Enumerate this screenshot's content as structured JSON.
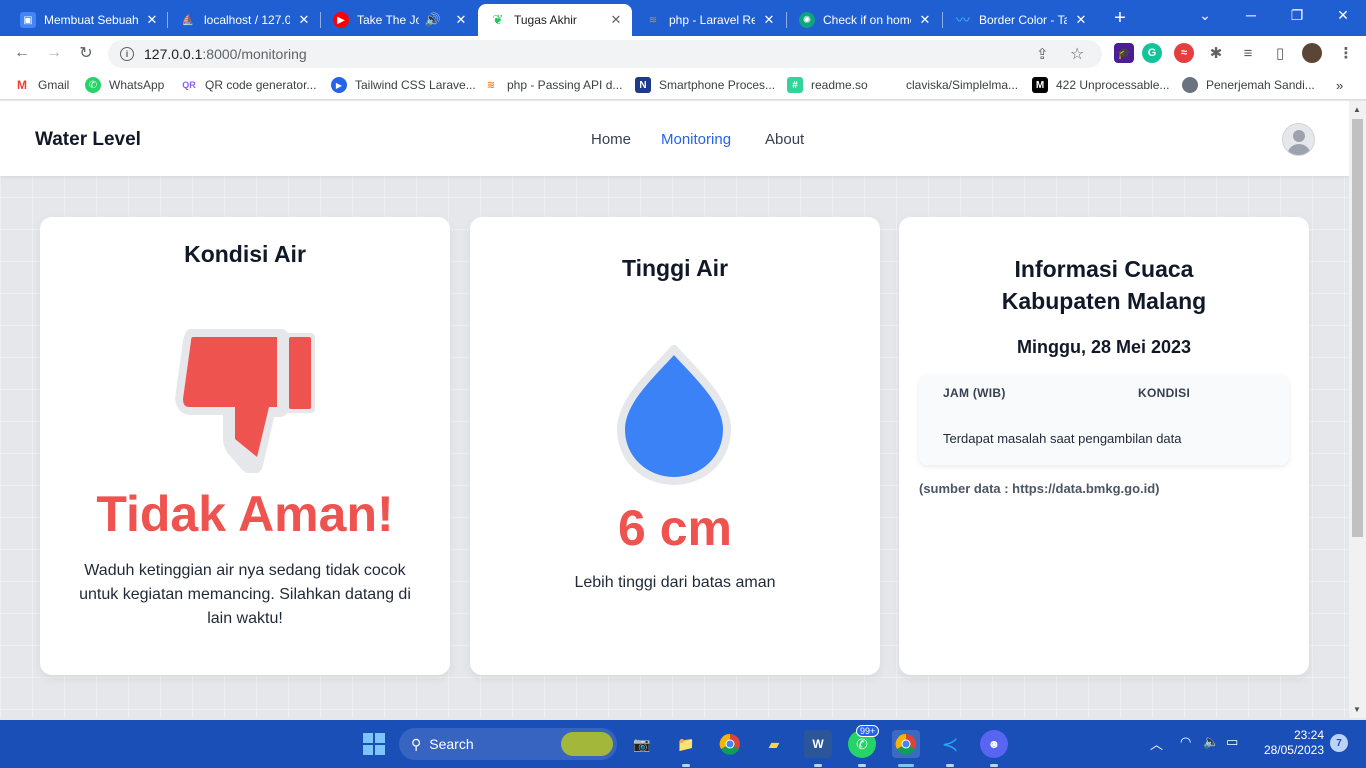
{
  "browser": {
    "tabs": [
      {
        "title": "Membuat Sebuah",
        "favicon": "profile-icon",
        "color": "#4285f4"
      },
      {
        "title": "localhost / 127.0.",
        "favicon": "phpmyadmin-icon",
        "color": "#f28c28"
      },
      {
        "title": "Take The Jour",
        "favicon": "youtube-music-icon",
        "color": "#ff0000"
      },
      {
        "title": "Tugas Akhir",
        "favicon": "leaf-icon",
        "color": "#22c55e"
      },
      {
        "title": "php - Laravel Re",
        "favicon": "stackoverflow-icon",
        "color": "#f48024"
      },
      {
        "title": "Check if on home",
        "favicon": "chatgpt-icon",
        "color": "#10a37f"
      },
      {
        "title": "Border Color - Ta",
        "favicon": "tailwind-icon",
        "color": "#38bdf8"
      }
    ],
    "url_host": "127.0.0.1",
    "url_path": ":8000/monitoring",
    "bookmarks": [
      {
        "label": "Gmail",
        "icon": "gmail-icon",
        "color": "#ea4335",
        "glyph": "M"
      },
      {
        "label": "WhatsApp",
        "icon": "whatsapp-icon",
        "color": "#25d366",
        "glyph": "W"
      },
      {
        "label": "QR code generator...",
        "icon": "qr-icon",
        "color": "#8b5cf6",
        "glyph": "QR"
      },
      {
        "label": "Tailwind CSS Larave...",
        "icon": "play-icon",
        "color": "#2563eb",
        "glyph": "▶"
      },
      {
        "label": "php - Passing API d...",
        "icon": "stackoverflow-icon",
        "color": "#f48024",
        "glyph": "S"
      },
      {
        "label": "Smartphone Proces...",
        "icon": "notion-icon",
        "color": "#1e3a8a",
        "glyph": "N"
      },
      {
        "label": "readme.so",
        "icon": "hash-icon",
        "color": "#34d399",
        "glyph": "#"
      },
      {
        "label": "claviska/Simplelma...",
        "icon": "blank-icon",
        "color": "#ffffff",
        "glyph": ""
      },
      {
        "label": "422 Unprocessable...",
        "icon": "medium-icon",
        "color": "#000000",
        "glyph": "M"
      },
      {
        "label": "Penerjemah Sandi...",
        "icon": "circle-icon",
        "color": "#6b7280",
        "glyph": ""
      }
    ]
  },
  "page": {
    "brand": "Water Level",
    "nav": [
      "Home",
      "Monitoring",
      "About"
    ],
    "active_nav": "Monitoring",
    "condition": {
      "title": "Kondisi Air",
      "status": "Tidak Aman!",
      "message": "Waduh ketinggian air nya sedang tidak cocok untuk kegiatan memancing. Silahkan datang di lain waktu!",
      "status_color": "#ef5350"
    },
    "height": {
      "title": "Tinggi Air",
      "value": "6 cm",
      "note": "Lebih tinggi dari batas aman",
      "drop_color": "#3b82f6"
    },
    "weather": {
      "title_line1": "Informasi Cuaca",
      "title_line2": "Kabupaten Malang",
      "date": "Minggu, 28 Mei 2023",
      "col_time": "JAM (WIB)",
      "col_condition": "KONDISI",
      "error": "Terdapat masalah saat pengambilan data",
      "source": "(sumber data : https://data.bmkg.go.id)"
    }
  },
  "taskbar": {
    "search_label": "Search",
    "whatsapp_badge": "99+",
    "time": "23:24",
    "date": "28/05/2023",
    "notifications": "7"
  }
}
